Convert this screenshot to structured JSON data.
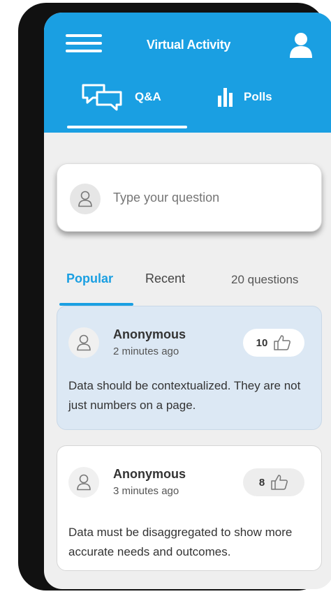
{
  "header": {
    "title": "Virtual Activity",
    "menu_icon": "hamburger-menu-icon",
    "profile_icon": "user-profile-icon"
  },
  "tabs": [
    {
      "label": "Q&A",
      "icon": "chat-bubbles-icon",
      "active": true
    },
    {
      "label": "Polls",
      "icon": "bar-chart-icon",
      "active": false
    }
  ],
  "ask": {
    "placeholder": "Type your question",
    "avatar_icon": "user-avatar-icon"
  },
  "filters": {
    "popular": "Popular",
    "recent": "Recent",
    "count": "20 questions",
    "active": "Popular"
  },
  "questions": [
    {
      "author": "Anonymous",
      "time": "2 minutes ago",
      "likes": "10",
      "text": "Data should be contextualized. They are not just numbers on a page.",
      "highlighted": true
    },
    {
      "author": "Anonymous",
      "time": "3 minutes ago",
      "likes": "8",
      "text": "Data must be disaggregated to show more accurate needs and outcomes.",
      "highlighted": false
    }
  ],
  "colors": {
    "brand": "#1a9fe2",
    "highlight_card": "#dce8f4",
    "background": "#efefef"
  }
}
